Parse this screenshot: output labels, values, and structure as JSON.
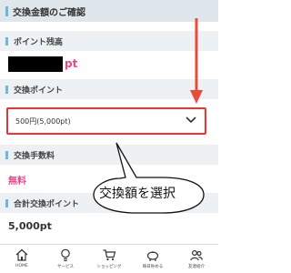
{
  "header": {
    "title": "交換金額のご確認"
  },
  "sections": {
    "points_balance": {
      "label": "ポイント残高",
      "value_suffix": "pt"
    },
    "exchange_points": {
      "label": "交換ポイント",
      "selected": "500円(5,000pt)"
    },
    "fee": {
      "label": "交換手数料",
      "value": "無料"
    },
    "total": {
      "label": "合計交換ポイント",
      "value": "5,000pt"
    }
  },
  "annotation": {
    "text": "交換額を選択",
    "arrow_color": "#e84c3d"
  },
  "colors": {
    "accent_pink": "#e8488c",
    "accent_blue": "#6fb7d6",
    "highlight_red": "#e33333"
  },
  "nav": [
    {
      "label": "HOME",
      "icon": "home-icon"
    },
    {
      "label": "サービス",
      "icon": "lightbulb-icon"
    },
    {
      "label": "ショッピング",
      "icon": "cart-icon"
    },
    {
      "label": "毎日貯める",
      "icon": "piggy-bank-icon"
    },
    {
      "label": "友達紹介",
      "icon": "friends-icon"
    }
  ]
}
